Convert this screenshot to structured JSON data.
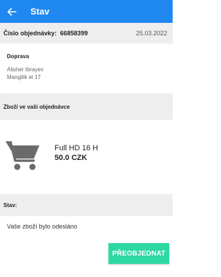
{
  "appbar": {
    "title": "Stav",
    "back_icon": "arrow-left-icon"
  },
  "order": {
    "label": "Číslo objednávky:",
    "number": "66858399",
    "date": "25.03.2022"
  },
  "delivery": {
    "heading": "Doprava",
    "name": "Alisher Ibrayev",
    "address": "Mangilik el 17"
  },
  "goods": {
    "heading": "Zboží ve vaší objednávce"
  },
  "product": {
    "icon": "shopping-cart-icon",
    "name": "Full HD 16 H",
    "price": "50.0 CZK"
  },
  "status": {
    "heading": "Stav:",
    "text": "Vaše zboží bylo odesláno"
  },
  "actions": {
    "reorder_label": "PŘEOBJEDNAT"
  },
  "colors": {
    "primary": "#1e88f0",
    "accent": "#2ed8a3",
    "section_bg": "#eeeeee"
  }
}
